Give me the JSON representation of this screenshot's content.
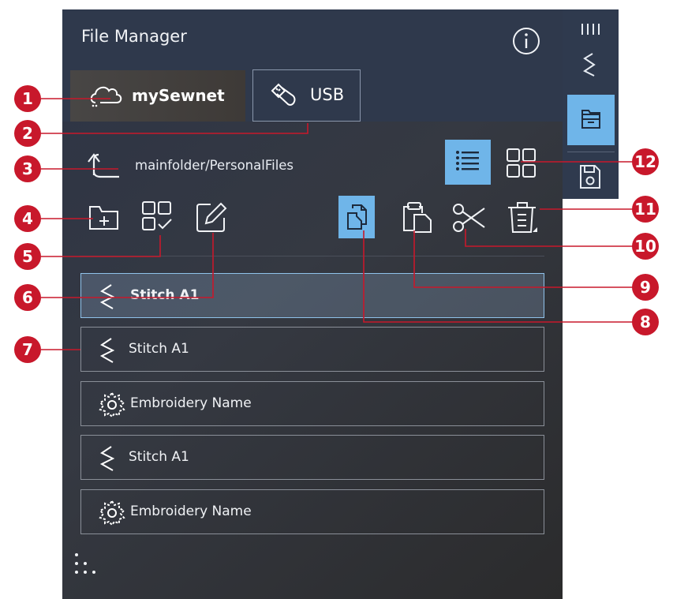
{
  "header": {
    "title": "File Manager",
    "info_icon": "info-icon"
  },
  "tabs": [
    {
      "label": "mySewnet",
      "icon": "cloud-icon",
      "selected": true
    },
    {
      "label": "USB",
      "icon": "usb-icon",
      "selected": false
    }
  ],
  "path": {
    "text": "mainfolder/PersonalFiles",
    "up_icon": "folder-up-icon"
  },
  "view": {
    "list_icon": "list-view-icon",
    "grid_icon": "grid-view-icon",
    "active": "list"
  },
  "toolbar": {
    "left": [
      "new-folder-icon",
      "select-multiple-icon",
      "rename-icon"
    ],
    "right": [
      "copy-icon",
      "paste-icon",
      "cut-icon",
      "delete-icon"
    ],
    "active": "copy"
  },
  "files": [
    {
      "name": "Stitch A1",
      "type": "stitch",
      "selected": true
    },
    {
      "name": "Stitch A1",
      "type": "stitch",
      "selected": false
    },
    {
      "name": "Embroidery Name",
      "type": "embroidery",
      "selected": false
    },
    {
      "name": "Stitch A1",
      "type": "stitch",
      "selected": false
    },
    {
      "name": "Embroidery Name",
      "type": "embroidery",
      "selected": false
    }
  ],
  "sidebar": {
    "items": [
      "stitch-menu-icon",
      "file-manager-icon",
      "save-icon"
    ],
    "active": "file-manager-icon"
  },
  "callouts": [
    "1",
    "2",
    "3",
    "4",
    "5",
    "6",
    "7",
    "8",
    "9",
    "10",
    "11",
    "12"
  ],
  "colors": {
    "header_bg": "#2f394c",
    "accent": "#6fb5e9",
    "callout": "#c8182b"
  }
}
